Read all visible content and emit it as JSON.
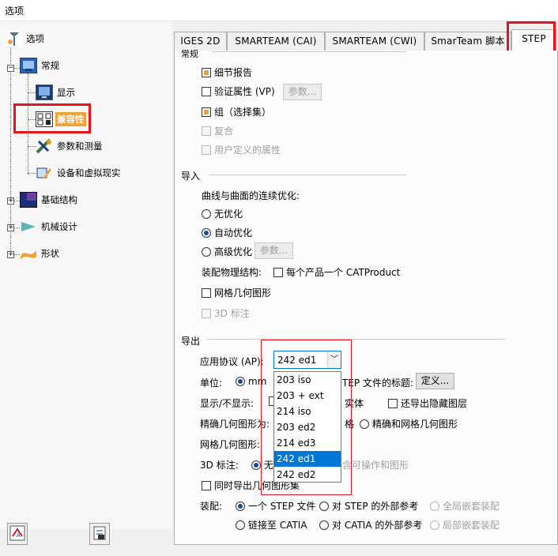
{
  "window": {
    "title": "选项"
  },
  "tree": {
    "root": "选项",
    "general": "常规",
    "display": "显示",
    "compat": "兼容性",
    "params": "参数和测量",
    "devices": "设备和虚拟现实",
    "infra": "基础结构",
    "mech": "机械设计",
    "shape": "形状"
  },
  "tabs": [
    "IGES 2D",
    "SMARTEAM (CAI)",
    "SMARTEAM (CWI)",
    "SmarTeam 脚本",
    "STEP"
  ],
  "general_section": {
    "title": "常规",
    "detail_report": "细节报告",
    "validation": "验证属性 (VP)",
    "params_btn": "参数...",
    "group": "组（选择集）",
    "composite": "复合",
    "user_attrs": "用户定义的属性"
  },
  "import_section": {
    "title": "导入",
    "curve_opt": "曲线与曲面的连续优化:",
    "no_opt": "无优化",
    "auto_opt": "自动优化",
    "adv_opt": "高级优化",
    "params_btn": "参数...",
    "assembly": "装配物理结构:",
    "per_product": "每个产品一个 CATProduct",
    "mesh": "网格几何图形",
    "annot": "3D 标注"
  },
  "export_section": {
    "title": "导出",
    "ap_label": "应用协议 (AP):",
    "ap_value": "242 ed1",
    "ap_options": [
      "203 iso",
      "203 + ext",
      "214 iso",
      "203 ed2",
      "214 ed3",
      "242 ed1",
      "242 ed2"
    ],
    "units_label": "单位:",
    "units_mm": "mm",
    "header_title": "TEP 文件的标题:",
    "define_btn": "定义...",
    "show_hide_label": "显示/不显示:",
    "solid": "实体",
    "export_hidden": "还导出隐藏图层",
    "exact_label": "精确几何图形为:",
    "mesh_frag": "格",
    "exact_mesh": "精确和网格几何图形",
    "mesh_label": "网格几何图形:",
    "annot_label": "3D 标注:",
    "annot_none": "无",
    "annot_frag": "含可操作和图形",
    "simul_mesh": "同时导出几何图形集",
    "assembly_label": "装配:",
    "one_step": "一个 STEP 文件",
    "ext_ref_step": "对 STEP 的外部参考",
    "full_nested": "全局嵌套装配",
    "link_catia": "链接至 CATIA",
    "ext_ref_catia": "对 CATIA 的外部参考",
    "local_nested": "局部嵌套装配"
  }
}
